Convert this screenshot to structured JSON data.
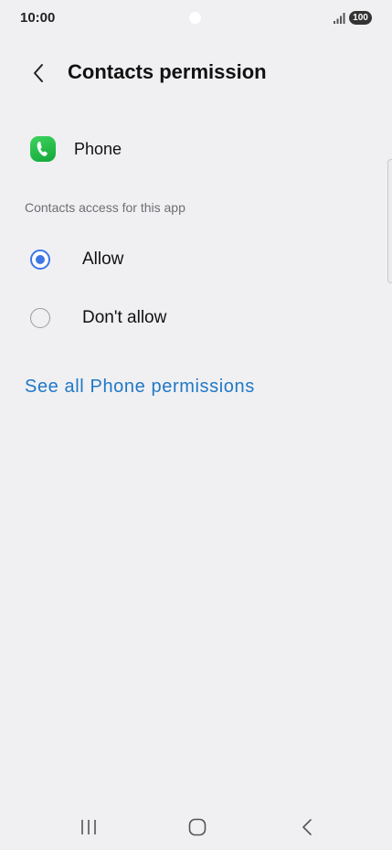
{
  "status_bar": {
    "time": "10:00",
    "battery": "100"
  },
  "header": {
    "title": "Contacts permission"
  },
  "app": {
    "name": "Phone",
    "icon": "phone-app-icon",
    "icon_color": "#1fb947"
  },
  "section": {
    "label": "Contacts access for this app"
  },
  "options": [
    {
      "label": "Allow",
      "selected": true
    },
    {
      "label": "Don't allow",
      "selected": false
    }
  ],
  "link": {
    "label": "See all Phone permissions"
  },
  "colors": {
    "accent": "#3e76e6",
    "link": "#1f78c6",
    "background": "#f0f0f3"
  }
}
